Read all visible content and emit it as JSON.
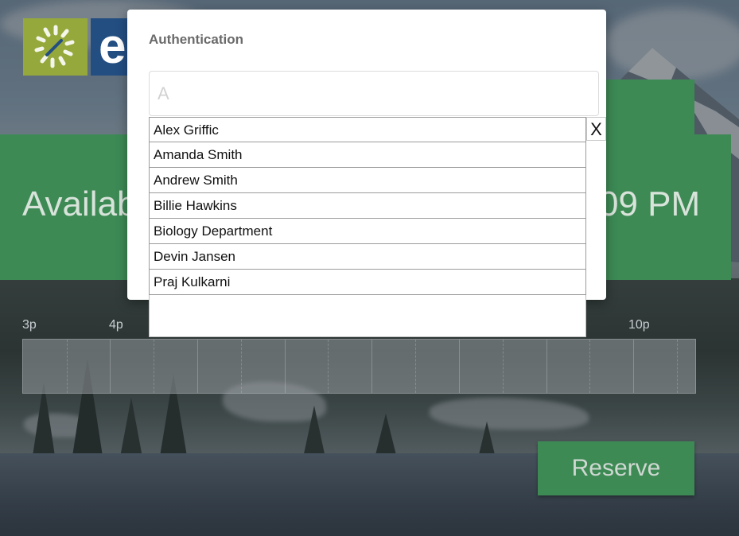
{
  "header": {
    "logo_letter": "e"
  },
  "banner": {
    "availability_text": "Availab",
    "time_text": "09 PM"
  },
  "timeline": {
    "ticks": [
      "3p",
      "4p",
      "10p"
    ]
  },
  "reserve_button": {
    "label": "Reserve"
  },
  "modal": {
    "title": "Authentication",
    "search": {
      "value": "",
      "placeholder": "A"
    },
    "close_label": "X",
    "suggestions": [
      "Alex Griffic",
      "Amanda Smith",
      "Andrew Smith",
      "Billie Hawkins",
      "Biology Department",
      "Devin Jansen",
      "Praj Kulkarni"
    ]
  },
  "colors": {
    "brand_green": "#3d8a55",
    "logo_olive": "#95a83b",
    "logo_blue": "#234e82"
  }
}
